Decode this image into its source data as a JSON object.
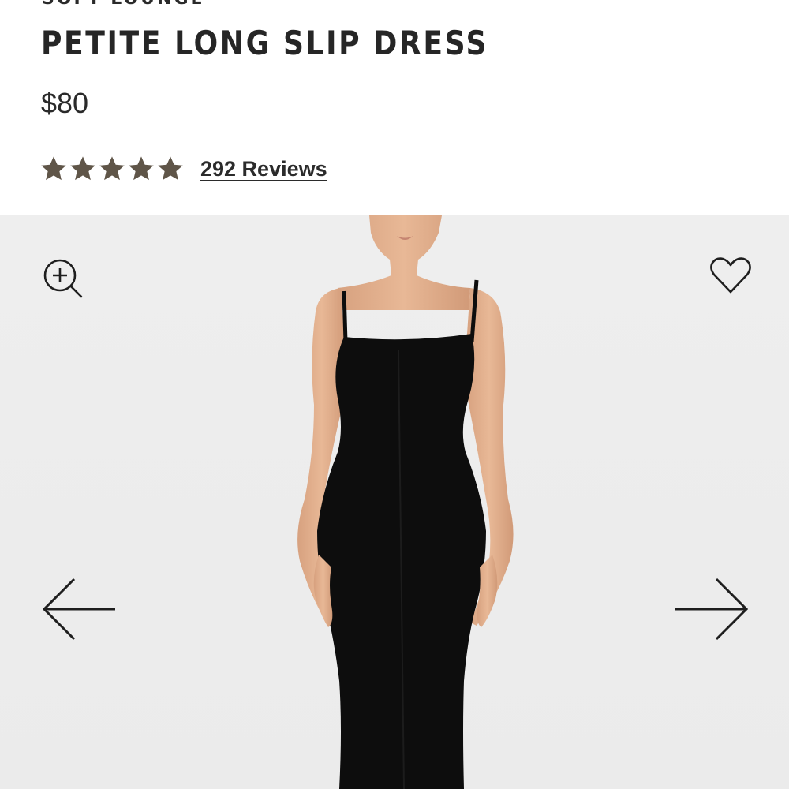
{
  "product": {
    "brand": "SOFT LOUNGE",
    "title": "PETITE LONG SLIP DRESS",
    "price": "$80",
    "rating": 5,
    "rating_max": 5,
    "reviews_label": "292 Reviews",
    "star_color": "#5f5548"
  },
  "gallery": {
    "background_color": "#eeeeee",
    "dress_color": "#0d0d0d",
    "icons": {
      "zoom": "zoom-in-icon",
      "favorite": "heart-icon",
      "previous": "arrow-left-icon",
      "next": "arrow-right-icon"
    }
  }
}
